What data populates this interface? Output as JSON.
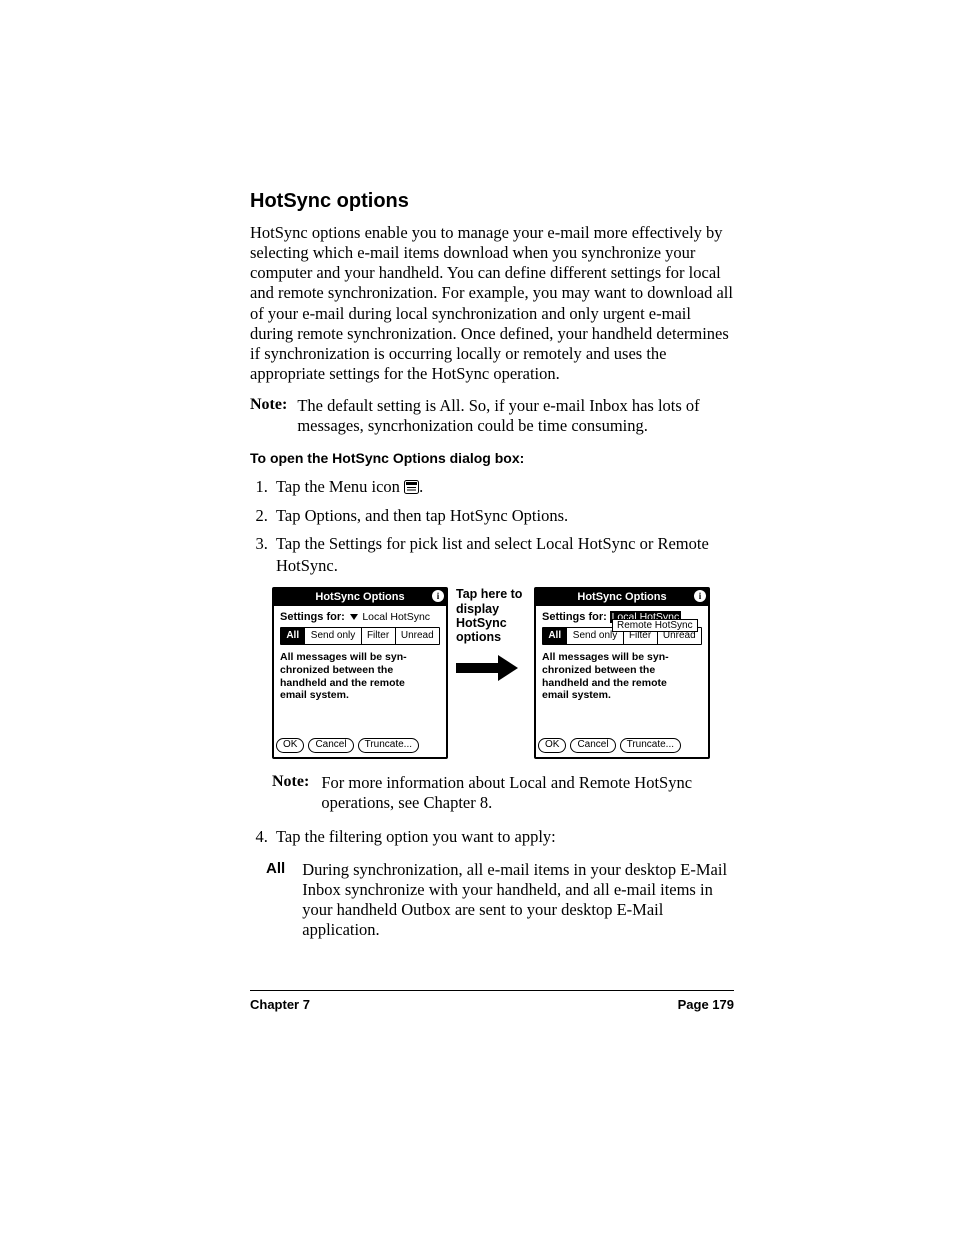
{
  "heading": "HotSync options",
  "intro": "HotSync options enable you to manage your e-mail more effectively by selecting which e-mail items download when you synchronize your computer and your handheld. You can define different settings for local and remote synchronization. For example, you may want to download all of your e-mail during local synchronization and only urgent e-mail during remote synchronization. Once defined, your handheld determines if synchronization is occurring locally or remotely and uses the appropriate settings for the HotSync operation.",
  "note1": {
    "label": "Note:",
    "text": "The default setting is All. So, if your e-mail Inbox has lots of messages, syncrhonization could be time consuming."
  },
  "subhead": "To open the HotSync Options dialog box:",
  "steps": {
    "s1a": "Tap the Menu icon ",
    "s1b": ".",
    "s2": "Tap Options, and then tap HotSync Options.",
    "s3": "Tap the Settings for pick list and select Local HotSync or Remote HotSync.",
    "s4": "Tap the filtering option you want to apply:"
  },
  "callout": "Tap here to display HotSync options",
  "dlg": {
    "title": "HotSync Options",
    "info_icon": "info-icon",
    "settings_label": "Settings for:",
    "picklist_closed": "Local HotSync",
    "picklist_open": [
      "Local HotSync",
      "Remote HotSync"
    ],
    "tabs": [
      "All",
      "Send only",
      "Filter",
      "Unread"
    ],
    "desc": "All messages will be syn-\nchronized between the\nhandheld and the remote\nemail system.",
    "buttons": {
      "ok": "OK",
      "cancel": "Cancel",
      "truncate": "Truncate..."
    }
  },
  "note2": {
    "label": "Note:",
    "text": "For more information about Local and Remote HotSync operations, see Chapter 8."
  },
  "def": {
    "term": "All",
    "body": "During synchronization, all e-mail items in your desktop E-Mail Inbox synchronize with your handheld, and all e-mail items in your handheld Outbox are sent to your desktop E-Mail application."
  },
  "footer": {
    "left": "Chapter 7",
    "right": "Page 179"
  }
}
